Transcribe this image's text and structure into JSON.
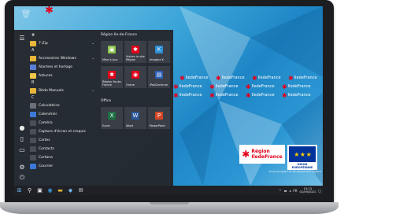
{
  "start_menu": {
    "rail_icons": [
      "hamburger-icon",
      "user-icon",
      "document-icon",
      "pictures-icon",
      "settings-icon",
      "power-icon"
    ],
    "apps": [
      {
        "type": "letter",
        "label": "#"
      },
      {
        "type": "app",
        "label": "7-Zip",
        "icon": "folder-icon",
        "color": "#e8b639",
        "chevron": true
      },
      {
        "type": "letter",
        "label": "A"
      },
      {
        "type": "app",
        "label": "Accessoires Windows",
        "icon": "folder-icon",
        "color": "#e8b639",
        "chevron": true
      },
      {
        "type": "app",
        "label": "Alarmes et horloge",
        "icon": "alarm-icon",
        "color": "#5a7fd6"
      },
      {
        "type": "app",
        "label": "Astuces",
        "icon": "lightbulb-icon",
        "color": "#f3c84a"
      },
      {
        "type": "letter",
        "label": "B"
      },
      {
        "type": "app",
        "label": "Bitdo Manuels",
        "icon": "folder-icon",
        "color": "#e8b639",
        "chevron": true
      },
      {
        "type": "letter",
        "label": "C"
      },
      {
        "type": "app",
        "label": "Calculatrice",
        "icon": "calculator-icon",
        "color": "#6b6f78"
      },
      {
        "type": "app",
        "label": "Calendrier",
        "icon": "calendar-icon",
        "color": "#3c78d8"
      },
      {
        "type": "app",
        "label": "Caméra",
        "icon": "camera-icon",
        "color": "#4a4e56"
      },
      {
        "type": "app",
        "label": "Capture d'écran et croquis",
        "icon": "snip-icon",
        "color": "#4a4e56"
      },
      {
        "type": "app",
        "label": "Cartes",
        "icon": "maps-icon",
        "color": "#4a4e56"
      },
      {
        "type": "app",
        "label": "Contacts",
        "icon": "contacts-icon",
        "color": "#4a4e56"
      },
      {
        "type": "app",
        "label": "Cortana",
        "icon": "cortana-icon",
        "color": "#4a4e56"
      },
      {
        "type": "app",
        "label": "Courrier",
        "icon": "mail-icon",
        "color": "#3c78d8"
      }
    ],
    "groups": [
      {
        "title": "Région Ile-de-France"
      },
      {
        "title": "Office"
      }
    ],
    "tiles": [
      {
        "label": "Mise à jour",
        "icon": "update-icon",
        "icon_color": "#8bc34a"
      },
      {
        "label": "Visitez le site Région",
        "icon": "star-icon",
        "icon_color": "#e2001a"
      },
      {
        "label": "Imagine K",
        "icon": "k-icon",
        "icon_color": "#2c8fd6"
      },
      {
        "label": "Région Ile-de-France",
        "icon": "star-icon",
        "icon_color": "#e2001a"
      },
      {
        "label": "Orane",
        "icon": "orane-icon",
        "icon_color": "#e2001a"
      },
      {
        "label": "iPadCentrum",
        "icon": "ipad-icon",
        "icon_color": "#2c5fb6"
      },
      {
        "label": "Excel",
        "icon": "excel-icon",
        "icon_color": "#1d7044"
      },
      {
        "label": "Word",
        "icon": "word-icon",
        "icon_color": "#2b579a"
      },
      {
        "label": "PowerPoint",
        "icon": "powerpoint-icon",
        "icon_color": "#d24726"
      }
    ]
  },
  "banner": {
    "region": "Région",
    "name": "IledeFrance"
  },
  "logos": {
    "region_top": "Région",
    "region_bottom": "IledeFrance",
    "eu_stars": "★ ★ ★",
    "eu_label": "UNION EUROPÉENNE",
    "eu_sub": "Fonds européen de développement régional"
  },
  "taskbar": {
    "icons": [
      "windows-start-icon",
      "search-icon",
      "task-view-icon",
      "edge-icon",
      "explorer-icon",
      "store-icon",
      "mail-icon"
    ],
    "tray_icons": [
      "chevron-up-icon",
      "network-icon",
      "volume-icon"
    ],
    "language": "FR",
    "time": "15:13",
    "date": "01/09/2021"
  },
  "colors": {
    "accent": "#e2001a",
    "menu_bg": "#24262c",
    "tile_bg": "#3a3e46"
  }
}
